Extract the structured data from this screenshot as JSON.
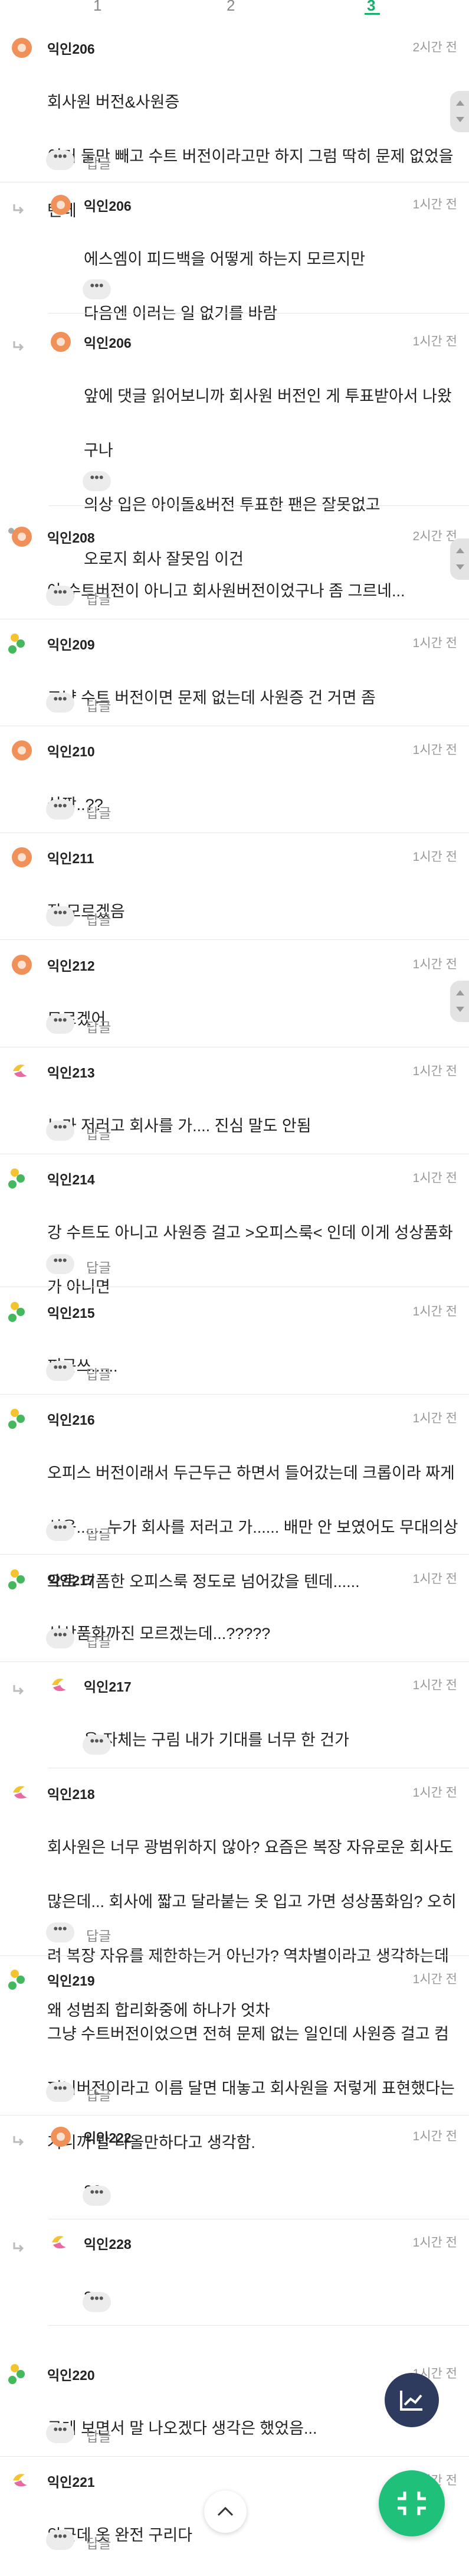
{
  "pagination": {
    "pages": [
      "1",
      "2",
      "3"
    ],
    "current": "3"
  },
  "colors": {
    "accent": "#14b06a",
    "orange_avatar": "#f0915a",
    "text_secondary": "#999999"
  },
  "comments": [
    {
      "author": "익인206",
      "time": "2시간 전",
      "lines": [
        "회사원 버전&사원증",
        "이거 둘만 빼고 수트 버전이라고만 하지 그럼 딱히 문제 없었을",
        "텐데"
      ],
      "reply_label": "답글"
    },
    {
      "author": "익인206",
      "time": "1시간 전",
      "lines": [
        "에스엠이 피드백을 어떻게 하는지 모르지만",
        "다음엔 이러는 일 없기를 바람"
      ]
    },
    {
      "author": "익인206",
      "time": "1시간 전",
      "lines": [
        "앞에 댓글 읽어보니까 회사원 버전인 게 투표받아서 나왔",
        "구나",
        "의상 입은 아이돌&버전 투표한 팬은 잘못없고",
        "오로지 회사 잘못임 이건"
      ]
    },
    {
      "author": "익인208",
      "time": "2시간 전",
      "lines": [
        "아 수트버전이 아니고 회사원버전이었구나 좀 그르네..."
      ],
      "reply_label": "답글"
    },
    {
      "author": "익인209",
      "time": "1시간 전",
      "lines": [
        "그냥 수트 버전이면 문제 없는데 사원증 건 거면 좀"
      ],
      "reply_label": "답글"
    },
    {
      "author": "익인210",
      "time": "1시간 전",
      "lines": [
        "살짝..??"
      ],
      "reply_label": "답글"
    },
    {
      "author": "익인211",
      "time": "1시간 전",
      "lines": [
        "잘 모르겠음"
      ],
      "reply_label": "답글"
    },
    {
      "author": "익인212",
      "time": "1시간 전",
      "lines": [
        "모르겠어"
      ],
      "reply_label": "답글"
    },
    {
      "author": "익인213",
      "time": "1시간 전",
      "lines": [
        "누가 저러고 회사를 가.... 진심 말도 안됨"
      ],
      "reply_label": "답글"
    },
    {
      "author": "익인214",
      "time": "1시간 전",
      "lines": [
        "강 수트도 아니고 사원증 걸고 >오피스룩< 인데 이게 성상품화",
        "가 아니면"
      ],
      "reply_label": "답글"
    },
    {
      "author": "익인215",
      "time": "1시간 전",
      "lines": [
        "피곤쓰......"
      ],
      "reply_label": "답글"
    },
    {
      "author": "익인216",
      "time": "1시간 전",
      "lines": [
        "오피스 버전이래서 두근두근 하면서 들어갔는데 크롭이라 짜게",
        "식음...... 누가 회사를 저러고 가...... 배만 안 보였어도 무대의상",
        "으로 리폼한 오피스룩 정도로 넘어갔을 텐데......"
      ],
      "reply_label": "답글"
    },
    {
      "author": "익인217",
      "time": "1시간 전",
      "lines": [
        "성상품화까진 모르겠는데...?????"
      ],
      "reply_label": "답글"
    },
    {
      "author": "익인217",
      "time": "1시간 전",
      "lines": [
        "옷 자체는 구림 내가 기대를 너무 한 건가"
      ]
    },
    {
      "author": "익인218",
      "time": "1시간 전",
      "lines": [
        "회사원은 너무 광범위하지 않아? 요즘은 복장 자유로운 회사도",
        "많은데... 회사에 짧고 달라붙는 옷 입고 가면 성상품화임? 오히",
        "려 복장 자유를 제한하는거 아닌가? 역차별이라고 생각하는데",
        "왜 성범죄 합리화중에 하나가 엇차"
      ],
      "reply_label": "답글"
    },
    {
      "author": "익인219",
      "time": "1시간 전",
      "lines": [
        "그냥 수트버전이었으면 전혀 문제 없는 일인데 사원증 걸고 컴",
        "퍼니버전이라고 이름 달면 대놓고 회사원을 저렇게 표현했다는",
        "거니까 말 나올만하다고 생각함."
      ],
      "reply_label": "답글"
    },
    {
      "author": "익인222",
      "time": "1시간 전",
      "lines": [
        "22"
      ]
    },
    {
      "author": "익인228",
      "time": "1시간 전",
      "lines": [
        "3"
      ]
    },
    {
      "author": "익인220",
      "time": "1시간 전",
      "lines": [
        "근데 보면서 말 나오겠다 생각은 했었음..."
      ],
      "reply_label": "답글"
    },
    {
      "author": "익인221",
      "time": "1시간 전",
      "lines": [
        "와근데 옷 완전 구리다"
      ],
      "reply_label": "답글"
    }
  ],
  "more_label": "•••"
}
